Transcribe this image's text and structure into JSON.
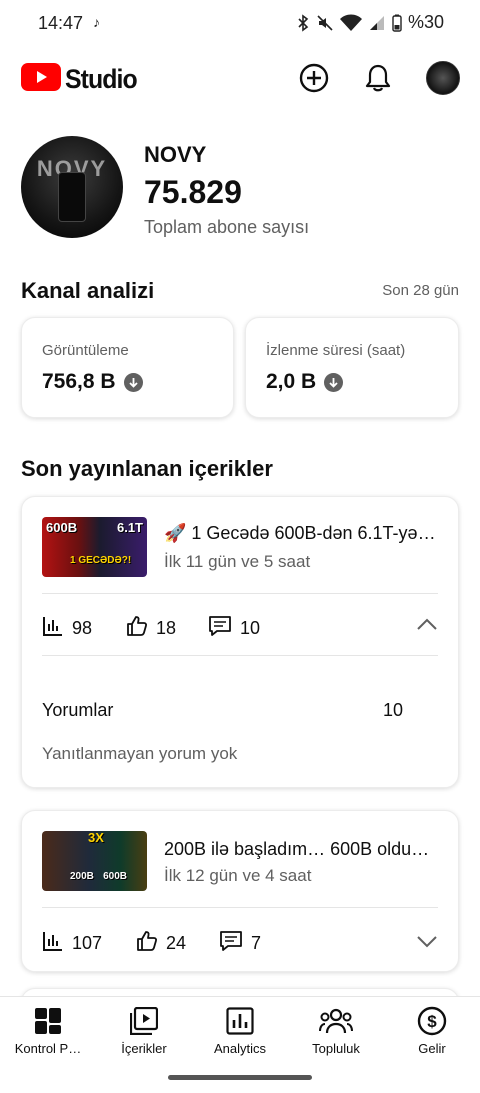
{
  "status_bar": {
    "time": "14:47",
    "notification_icon": "tiktok-icon",
    "battery": "%30"
  },
  "header": {
    "logo_text": "Studio",
    "create_icon": "plus-circle-icon",
    "notification_icon": "bell-icon"
  },
  "channel": {
    "name": "NOVY",
    "subscribers": "75.829",
    "subscribers_label": "Toplam abone sayısı",
    "avatar_text": "NOVY"
  },
  "analytics": {
    "title": "Kanal analizi",
    "period": "Son 28 gün",
    "cards": [
      {
        "label": "Görüntüleme",
        "value": "756,8 B",
        "trend": "down"
      },
      {
        "label": "İzlenme süresi (saat)",
        "value": "2,0 B",
        "trend": "down"
      }
    ]
  },
  "recent": {
    "title": "Son yayınlanan içerikler",
    "videos": [
      {
        "title": "🚀 1 Gecədə 600B-dən 6.1T-yə …",
        "subtitle": "İlk 11 gün ve 5 saat",
        "thumb_text_a": "600B",
        "thumb_text_b": "6.1T",
        "thumb_text_c": "1 GECƏDƏ?!",
        "views": "98",
        "likes": "18",
        "comments": "10",
        "expanded": true,
        "comments_row_label": "Yorumlar",
        "comments_row_value": "10",
        "comments_note": "Yanıtlanmayan yorum yok"
      },
      {
        "title": " 200B ilə başladım… 600B oldu…",
        "subtitle": "İlk 12 gün ve 4 saat",
        "thumb_text_a": "3X",
        "thumb_text_b": "200B",
        "thumb_text_c": "600B",
        "views": "107",
        "likes": "24",
        "comments": "7",
        "expanded": false
      }
    ]
  },
  "bottom_nav": [
    {
      "label": "Kontrol P…",
      "icon": "dashboard-icon"
    },
    {
      "label": "İçerikler",
      "icon": "content-icon"
    },
    {
      "label": "Analytics",
      "icon": "analytics-icon"
    },
    {
      "label": "Topluluk",
      "icon": "community-icon"
    },
    {
      "label": "Gelir",
      "icon": "earn-icon"
    }
  ]
}
